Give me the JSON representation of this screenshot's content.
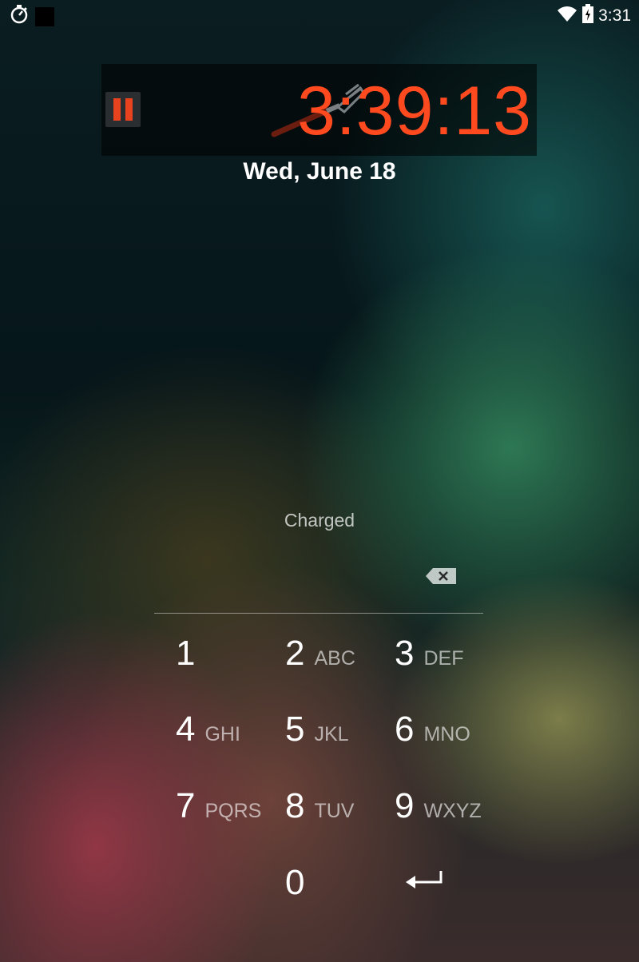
{
  "status_bar": {
    "time": "3:31",
    "icons": [
      "stopwatch-icon",
      "notification-square-icon",
      "wifi-icon",
      "battery-charging-icon"
    ]
  },
  "clock_widget": {
    "time": "3:39:13",
    "accent_color": "#ff4a20",
    "icons": [
      "pause-icon",
      "fork-icon"
    ]
  },
  "lockscreen": {
    "date": "Wed, June 18",
    "status": "Charged"
  },
  "keypad": {
    "keys": [
      {
        "num": "1",
        "letters": ""
      },
      {
        "num": "2",
        "letters": "ABC"
      },
      {
        "num": "3",
        "letters": "DEF"
      },
      {
        "num": "4",
        "letters": "GHI"
      },
      {
        "num": "5",
        "letters": "JKL"
      },
      {
        "num": "6",
        "letters": "MNO"
      },
      {
        "num": "7",
        "letters": "PQRS"
      },
      {
        "num": "8",
        "letters": "TUV"
      },
      {
        "num": "9",
        "letters": "WXYZ"
      },
      {
        "num": "0",
        "letters": ""
      }
    ],
    "icons": [
      "backspace-icon",
      "enter-icon"
    ]
  }
}
